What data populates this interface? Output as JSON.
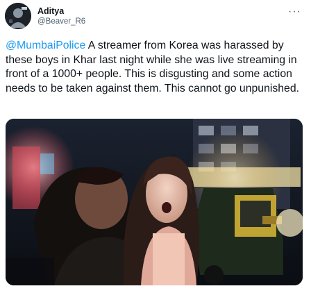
{
  "user": {
    "display_name": "Aditya",
    "handle": "@Beaver_R6",
    "avatar_icon": "user-avatar"
  },
  "menu": {
    "more_label": "···",
    "icon": "more-dots-icon"
  },
  "tweet": {
    "mention": "@MumbaiPolice",
    "text": " A streamer from Korea was harassed by these boys in Khar last night while she was live streaming in front of a 1000+ people. This is disgusting and some action needs to be taken against them. This cannot go unpunished."
  },
  "colors": {
    "link": "#1d9bf0",
    "text": "#0f1419",
    "secondary": "#536471"
  }
}
